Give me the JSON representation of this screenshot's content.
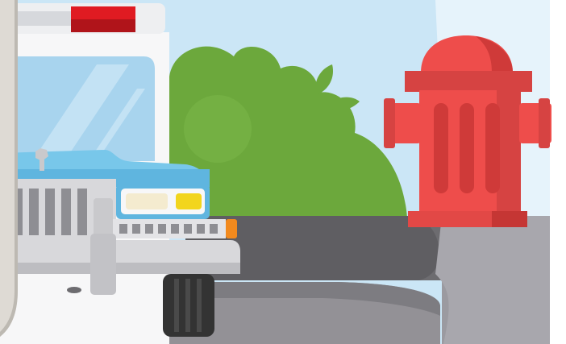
{
  "illustration": {
    "subject": "",
    "colors": {
      "sky": "#cbe6f6",
      "frame_left": "#dedad4",
      "frame_right": "#f4f4f4",
      "bush": "#6ca83c",
      "bush_dark": "#5e9632",
      "pavement": "#6d6c70",
      "curb": "#939196",
      "curb_top": "#b5b3b8",
      "hydrant": "#ee4d4b",
      "hydrant_dark": "#cf3a39",
      "truck_white": "#f7f7f8",
      "truck_blue": "#78c7ea",
      "windshield": "#a8d4ee",
      "siren_red": "#e01b22",
      "grille": "#c9c9cc",
      "bumper": "#d8d8db",
      "tire": "#333333",
      "headlight": "#f4ebcf",
      "foglight": "#f2d51d",
      "turn_signal": "#f28a1e"
    },
    "icons": [
      "siren-light-bar",
      "hood-ornament",
      "fire-hydrant",
      "bush"
    ]
  }
}
